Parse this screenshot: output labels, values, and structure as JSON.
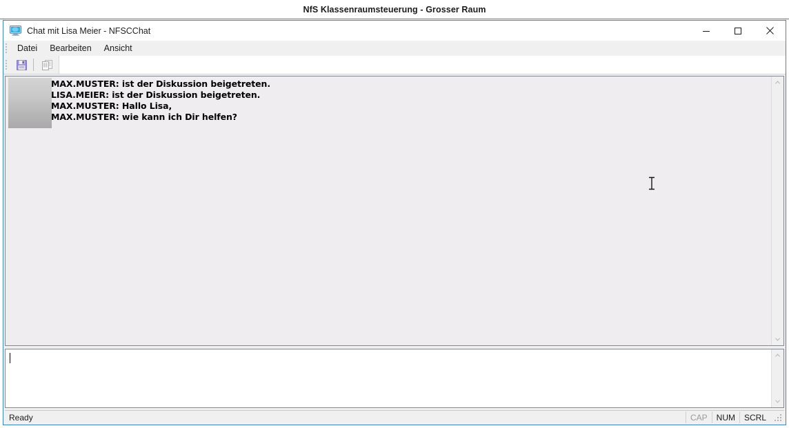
{
  "outer_window": {
    "title": "NfS Klassenraumsteuerung - Grosser Raum",
    "accent_color": "#3a87c8"
  },
  "chat_window": {
    "title": "Chat mit Lisa Meier - NFSCChat",
    "icon": "monitor-screen-icon",
    "controls": {
      "minimize_label": "Minimieren",
      "maximize_label": "Maximieren",
      "close_label": "Schliessen"
    },
    "menubar": {
      "items": [
        {
          "label": "Datei"
        },
        {
          "label": "Bearbeiten"
        },
        {
          "label": "Ansicht"
        }
      ]
    },
    "toolbar": {
      "buttons": [
        {
          "name": "save-button",
          "icon": "floppy-disk-icon",
          "enabled": true
        },
        {
          "name": "copy-button",
          "icon": "copy-icon",
          "enabled": false
        }
      ]
    },
    "transcript": {
      "messages": [
        {
          "sender": "MAX.MUSTER",
          "text": "MAX.MUSTER: ist der Diskussion beigetreten."
        },
        {
          "sender": "LISA.MEIER",
          "text": "LISA.MEIER: ist der Diskussion beigetreten."
        },
        {
          "sender": "MAX.MUSTER",
          "text": "MAX.MUSTER: Hallo Lisa,"
        },
        {
          "sender": "MAX.MUSTER",
          "text": "MAX.MUSTER: wie kann ich Dir helfen?"
        }
      ],
      "scrollbar": {
        "up_arrow": "chevron-up-icon",
        "down_arrow": "chevron-down-icon"
      }
    },
    "input": {
      "value": "",
      "placeholder": "",
      "scrollbar": {
        "up_arrow": "chevron-up-icon",
        "down_arrow": "chevron-down-icon"
      }
    },
    "statusbar": {
      "message": "Ready",
      "indicators": [
        {
          "label": "CAP",
          "active": false
        },
        {
          "label": "NUM",
          "active": true
        },
        {
          "label": "SCRL",
          "active": true
        }
      ]
    }
  }
}
